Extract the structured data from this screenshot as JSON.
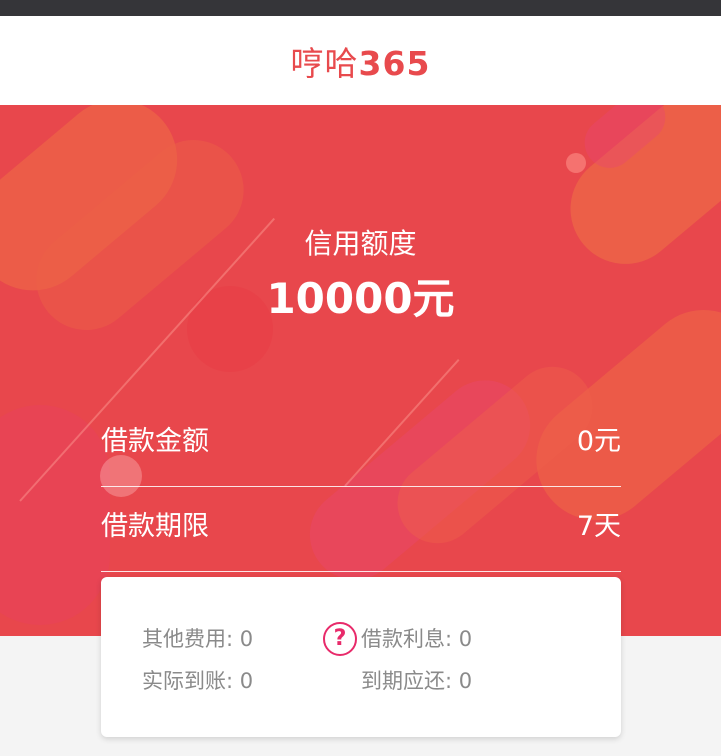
{
  "header": {
    "title_cn": "哼哈",
    "title_num": "365"
  },
  "credit": {
    "label": "信用额度",
    "value": "10000元"
  },
  "loan": {
    "amount_label": "借款金额",
    "amount_value": "0元",
    "term_label": "借款期限",
    "term_value": "7天"
  },
  "fees": {
    "other_label": "其他费用:",
    "other_value": "0",
    "interest_label": "借款利息:",
    "interest_value": "0",
    "actual_label": "实际到账:",
    "actual_value": "0",
    "due_label": "到期应还:",
    "due_value": "0"
  },
  "icons": {
    "help": "question-circle-icon"
  },
  "colors": {
    "brand_red": "#e8474c",
    "help_pink": "#e82a6a",
    "title_red": "#e84a4d"
  }
}
